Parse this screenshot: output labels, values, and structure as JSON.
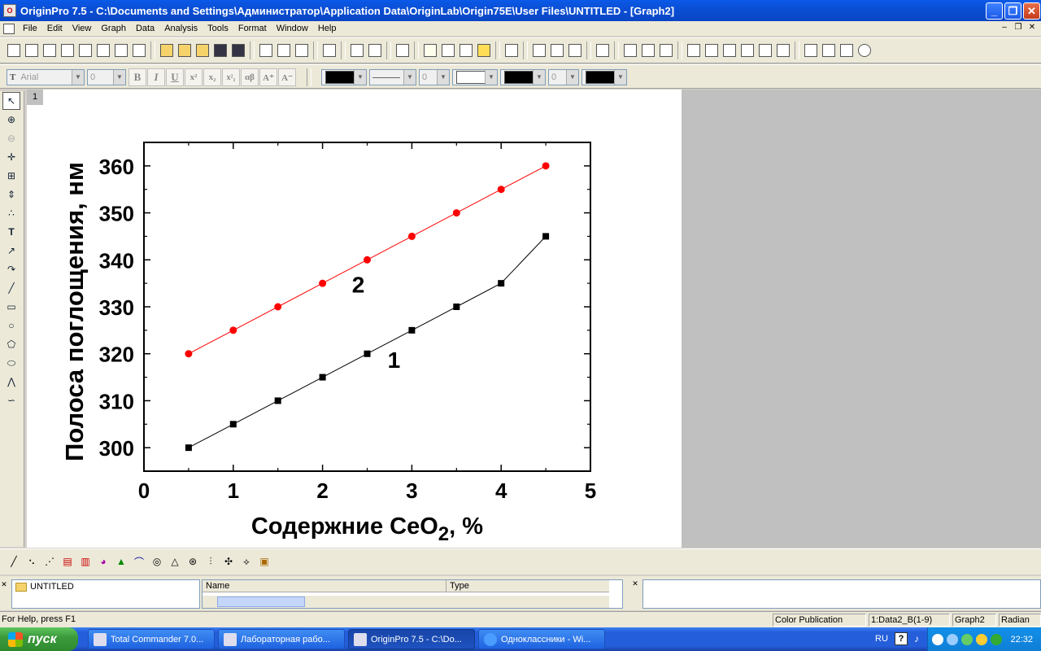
{
  "window": {
    "title": "OriginPro 7.5 - C:\\Documents and Settings\\Администратор\\Application Data\\OriginLab\\Origin75E\\User Files\\UNTITLED - [Graph2]",
    "minimize": "_",
    "maximize": "❐",
    "close": "✕"
  },
  "menu": [
    "File",
    "Edit",
    "View",
    "Graph",
    "Data",
    "Analysis",
    "Tools",
    "Format",
    "Window",
    "Help"
  ],
  "format_toolbar": {
    "font": "Arial",
    "font_size": "0",
    "bold": "B",
    "italic": "I",
    "underline": "U",
    "superscript": "x²",
    "subscript": "x₂",
    "supsub": "x²₁",
    "greek": "αβ",
    "increase_font": "A⁺",
    "decrease_font": "A⁻",
    "line_width": "0",
    "pattern_width": "0"
  },
  "layer_tab": "1",
  "chart_data": {
    "type": "line",
    "xlabel": "Содержние CeO",
    "xlabel_sub": "2",
    "xlabel_suffix": ", %",
    "ylabel": "Полоса поглощения, нм",
    "xlim": [
      0,
      5
    ],
    "ylim": [
      295,
      365
    ],
    "xticks": [
      0,
      1,
      2,
      3,
      4,
      5
    ],
    "yticks": [
      300,
      310,
      320,
      330,
      340,
      350,
      360
    ],
    "series": [
      {
        "name": "1",
        "color": "#000000",
        "marker": "square",
        "x": [
          0.5,
          1.0,
          1.5,
          2.0,
          2.5,
          3.0,
          3.5,
          4.0,
          4.5
        ],
        "y": [
          300,
          305,
          310,
          315,
          320,
          325,
          330,
          335,
          345
        ]
      },
      {
        "name": "2",
        "color": "#ff0000",
        "marker": "circle",
        "x": [
          0.5,
          1.0,
          1.5,
          2.0,
          2.5,
          3.0,
          3.5,
          4.0,
          4.5
        ],
        "y": [
          320,
          325,
          330,
          335,
          340,
          345,
          350,
          355,
          360
        ]
      }
    ],
    "annotations": [
      {
        "text": "2",
        "x": 2.4,
        "y": 333
      },
      {
        "text": "1",
        "x": 2.8,
        "y": 317
      }
    ]
  },
  "project_explorer": {
    "folder": "UNTITLED",
    "col_name": "Name",
    "col_type": "Type"
  },
  "status": {
    "help": "For Help, press F1",
    "template": "Color Publication",
    "active_data": "1:Data2_B(1-9)",
    "window": "Graph2",
    "angle": "Radian"
  },
  "taskbar": {
    "start": "пуск",
    "tasks": [
      "Total Commander 7.0...",
      "Лабораторная рабо...",
      "OriginPro 7.5 - C:\\Do...",
      "Одноклассники - Wi..."
    ],
    "lang": "RU",
    "help": "?",
    "clock": "22:32"
  }
}
